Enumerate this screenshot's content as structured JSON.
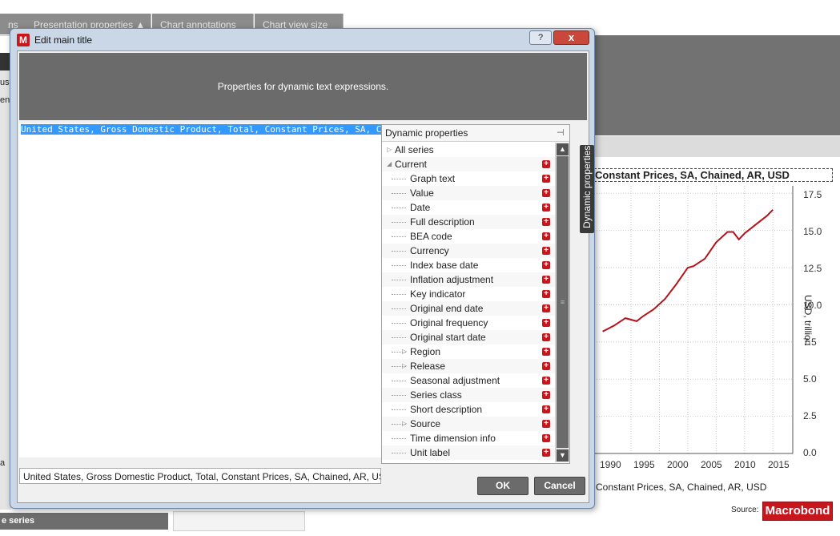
{
  "background": {
    "tabs": [
      "ns",
      "Presentation properties",
      "Chart annotations",
      "Chart view size"
    ],
    "left_text": [
      "ust",
      "ent",
      "a"
    ],
    "series_button": "e series",
    "chart": {
      "title": "Constant Prices, SA, Chained, AR, USD",
      "footer": "Constant Prices, SA, Chained, AR, USD",
      "source_label": "Source:",
      "logo": "Macrobond",
      "ylabel": "USD, trillion",
      "yticks": [
        "17.5",
        "15.0",
        "12.5",
        "10.0",
        "7.5",
        "5.0",
        "2.5",
        "0.0"
      ],
      "xticks": [
        "1990",
        "1995",
        "2000",
        "2005",
        "2010",
        "2015"
      ],
      "line_color": "#b5121b"
    }
  },
  "chart_data": {
    "type": "line",
    "ylabel": "USD, trillion",
    "ylim": [
      0,
      17.5
    ],
    "grid": true,
    "series": [
      {
        "x": [
          1985,
          1987,
          1989,
          1991,
          1992,
          1994,
          1996,
          1998,
          2000,
          2001,
          2003,
          2005,
          2007,
          2008,
          2009,
          2010,
          2012,
          2014,
          2015
        ],
        "values": [
          8.2,
          8.6,
          9.1,
          8.9,
          9.2,
          9.7,
          10.4,
          11.4,
          12.5,
          12.6,
          13.1,
          14.2,
          14.9,
          14.9,
          14.4,
          14.8,
          15.4,
          16.0,
          16.4
        ]
      }
    ]
  },
  "dialog": {
    "title": "Edit main title",
    "icon_letter": "M",
    "help_label": "?",
    "close_label": "x",
    "header_text": "Properties for dynamic text expressions.",
    "editor_text": "United States, Gross Domestic Product, Total, Constant Prices, SA, C",
    "preview_text": "United States, Gross Domestic Product, Total, Constant Prices, SA, Chained, AR, USD",
    "ok_label": "OK",
    "cancel_label": "Cancel",
    "side_tab_label": "Dynamic properties",
    "dynamic_properties": {
      "title": "Dynamic properties",
      "items": [
        {
          "label": "All series",
          "level": 0,
          "expander": "collapsed"
        },
        {
          "label": "Current",
          "level": 0,
          "expander": "expanded"
        },
        {
          "label": "Graph text",
          "level": 1
        },
        {
          "label": "Value",
          "level": 1
        },
        {
          "label": "Date",
          "level": 1
        },
        {
          "label": "Full description",
          "level": 1
        },
        {
          "label": "BEA code",
          "level": 1
        },
        {
          "label": "Currency",
          "level": 1
        },
        {
          "label": "Index base date",
          "level": 1
        },
        {
          "label": "Inflation adjustment",
          "level": 1
        },
        {
          "label": "Key indicator",
          "level": 1
        },
        {
          "label": "Original end date",
          "level": 1
        },
        {
          "label": "Original frequency",
          "level": 1
        },
        {
          "label": "Original start date",
          "level": 1
        },
        {
          "label": "Region",
          "level": 1,
          "expander": "collapsed"
        },
        {
          "label": "Release",
          "level": 1,
          "expander": "collapsed"
        },
        {
          "label": "Seasonal adjustment",
          "level": 1
        },
        {
          "label": "Series class",
          "level": 1
        },
        {
          "label": "Short description",
          "level": 1
        },
        {
          "label": "Source",
          "level": 1,
          "expander": "collapsed"
        },
        {
          "label": "Time dimension info",
          "level": 1
        },
        {
          "label": "Unit label",
          "level": 1
        }
      ]
    }
  }
}
